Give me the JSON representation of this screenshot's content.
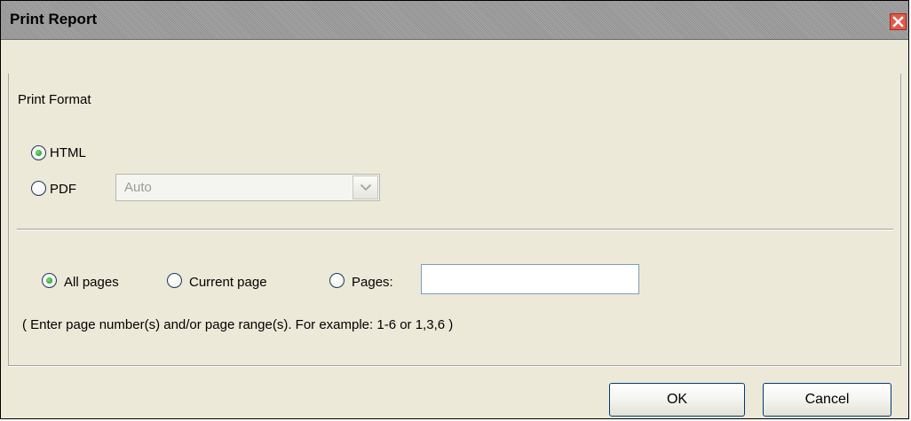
{
  "dialog": {
    "title": "Print Report",
    "close_icon": "close-icon"
  },
  "print_format": {
    "heading": "Print Format",
    "options": [
      {
        "label": "HTML",
        "selected": true
      },
      {
        "label": "PDF",
        "selected": false
      }
    ],
    "pdf_select": {
      "value": "Auto",
      "icon": "chevron-down-icon",
      "disabled": true
    }
  },
  "page_range": {
    "options": [
      {
        "label": "All pages",
        "selected": true
      },
      {
        "label": "Current page",
        "selected": false
      },
      {
        "label": "Pages:",
        "selected": false
      }
    ],
    "pages_value": "",
    "hint": "( Enter page number(s) and/or page range(s). For example: 1-6 or 1,3,6 )"
  },
  "buttons": {
    "ok_label": "OK",
    "cancel_label": "Cancel"
  },
  "colors": {
    "dialog_bg": "#ece9d8",
    "close_red": "#e05a4a",
    "radio_selected_green": "#2aa62a",
    "button_border": "#003c74"
  }
}
